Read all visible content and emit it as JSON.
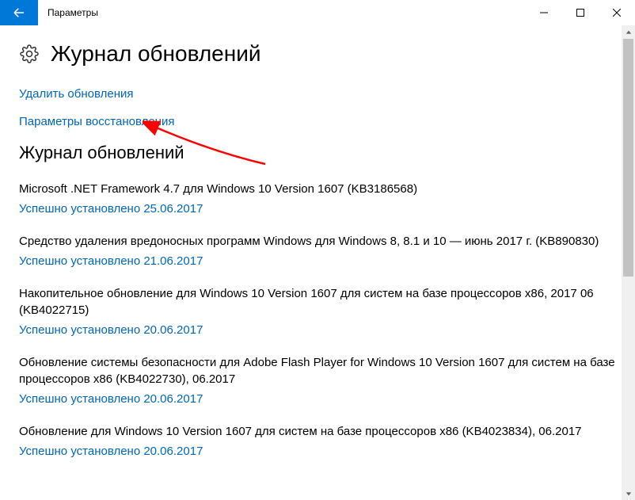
{
  "window": {
    "title": "Параметры"
  },
  "header": {
    "page_title": "Журнал обновлений"
  },
  "links": {
    "uninstall": "Удалить обновления",
    "recovery": "Параметры восстановления"
  },
  "section": {
    "heading": "Журнал обновлений"
  },
  "updates": [
    {
      "name": "Microsoft .NET Framework 4.7 для Windows 10 Version 1607 (KB3186568)",
      "status": "Успешно установлено 25.06.2017"
    },
    {
      "name": "Средство удаления вредоносных программ Windows для Windows 8, 8.1 и 10 — июнь 2017 г. (KB890830)",
      "status": "Успешно установлено 21.06.2017"
    },
    {
      "name": "Накопительное обновление для Windows 10 Version 1607 для систем на базе процессоров x86, 2017 06 (KB4022715)",
      "status": "Успешно установлено 20.06.2017"
    },
    {
      "name": "Обновление системы безопасности для Adobe Flash Player for Windows 10 Version 1607 для систем на базе процессоров x86 (KB4022730), 06.2017",
      "status": "Успешно установлено 20.06.2017"
    },
    {
      "name": "Обновление для Windows 10 Version 1607 для систем на базе процессоров x86 (KB4023834), 06.2017",
      "status": "Успешно установлено 20.06.2017"
    }
  ]
}
